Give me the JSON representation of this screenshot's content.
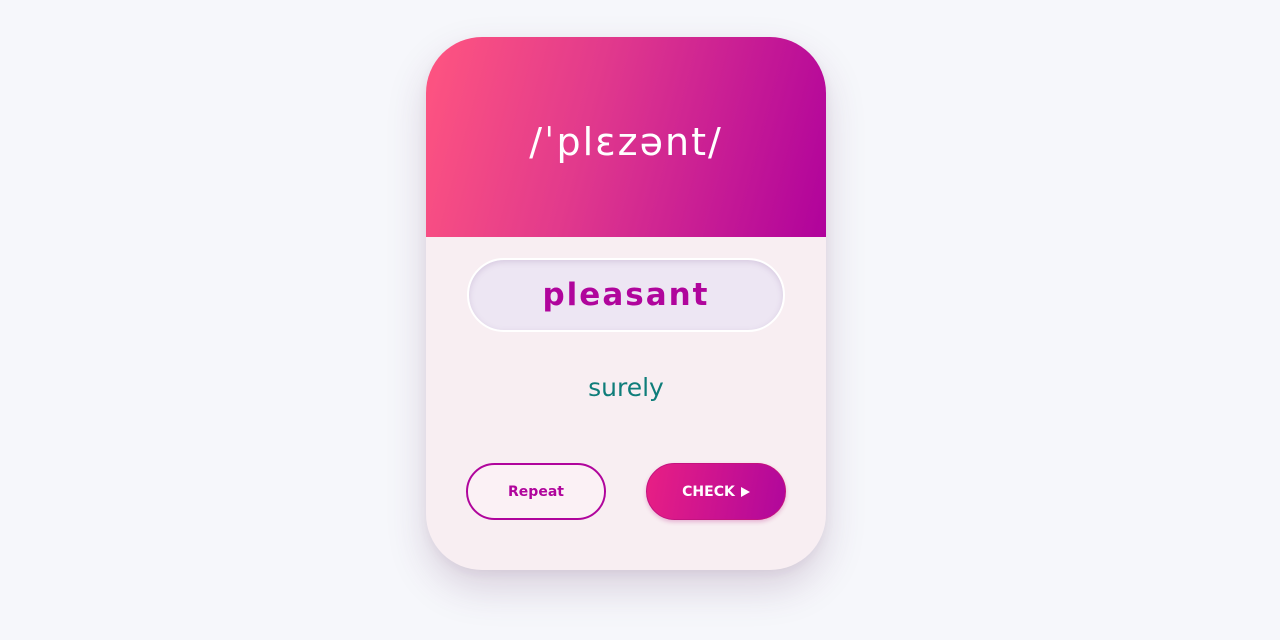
{
  "card": {
    "phonetic": "/ˈplɛzənt/",
    "word": "pleasant",
    "hint": "surely"
  },
  "buttons": {
    "repeat_label": "Repeat",
    "check_label": "CHECK",
    "check_icon": "play-icon"
  },
  "colors": {
    "accent": "#b0059c",
    "header_gradient_start": "#ff5580",
    "header_gradient_end": "#b0029c",
    "hint_text": "#0f7d7a",
    "card_background": "#f8eef2"
  }
}
